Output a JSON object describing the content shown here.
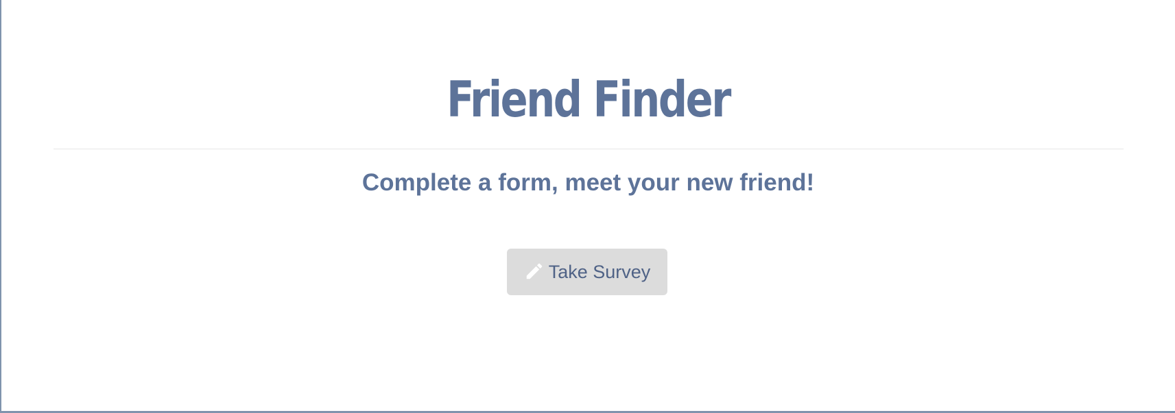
{
  "header": {
    "title": "Friend Finder",
    "subtitle": "Complete a form, meet your new friend!"
  },
  "actions": {
    "survey_button": {
      "label": "Take Survey",
      "icon": "pencil-icon"
    }
  },
  "colors": {
    "text_primary": "#5d7399",
    "button_bg": "#dcdcdc",
    "button_text": "#4f6286",
    "frame_border": "#7f93ad"
  }
}
